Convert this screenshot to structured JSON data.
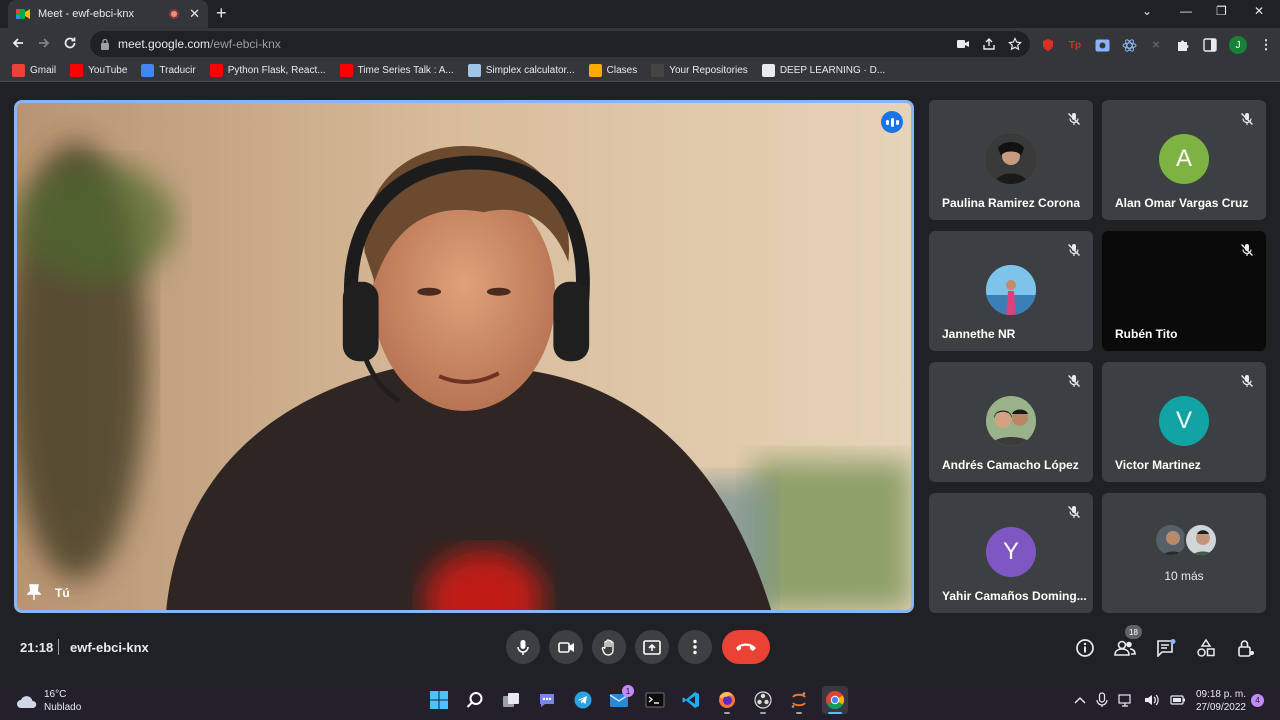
{
  "browser": {
    "tab_title": "Meet - ewf-ebci-knx",
    "url_host": "meet.google.com",
    "url_path": "/ewf-ebci-knx",
    "profile_initial": "J",
    "bookmarks": [
      {
        "label": "Gmail",
        "icon": "gmail-icon",
        "color": "#ea4335"
      },
      {
        "label": "YouTube",
        "icon": "youtube-icon",
        "color": "#ff0000"
      },
      {
        "label": "Traducir",
        "icon": "translate-icon",
        "color": "#4285f4"
      },
      {
        "label": "Python Flask, React...",
        "icon": "youtube-icon",
        "color": "#ff0000"
      },
      {
        "label": "Time Series Talk : A...",
        "icon": "youtube-icon",
        "color": "#ff0000"
      },
      {
        "label": "Simplex calculator...",
        "icon": "simplex-icon",
        "color": "#9fc5e8"
      },
      {
        "label": "Clases",
        "icon": "classroom-icon",
        "color": "#f9ab00"
      },
      {
        "label": "Your Repositories",
        "icon": "github-icon",
        "color": "#444"
      },
      {
        "label": "DEEP LEARNING · D...",
        "icon": "letter-l-icon",
        "color": "#e8eaed"
      }
    ]
  },
  "meeting": {
    "self_label": "Tú",
    "time": "21:18",
    "code": "ewf-ebci-knx",
    "participant_count": "18",
    "participants": [
      {
        "name": "Paulina Ramirez Corona",
        "initial": "",
        "avatar_color": "#111"
      },
      {
        "name": "Alan Omar Vargas Cruz",
        "initial": "A",
        "avatar_color": "#7cb342"
      },
      {
        "name": "Jannethe NR",
        "initial": "",
        "avatar_color": "#4fa3d9"
      },
      {
        "name": "Rubén Tito",
        "initial": "",
        "avatar_color": "#0a0a0a"
      },
      {
        "name": "Andrés Camacho López",
        "initial": "",
        "avatar_color": "#6b5a4a"
      },
      {
        "name": "Victor Martinez",
        "initial": "V",
        "avatar_color": "#12a4a4"
      },
      {
        "name": "Yahir Camaños Doming...",
        "initial": "Y",
        "avatar_color": "#7e57c2"
      }
    ],
    "more_label": "10 más",
    "colors": {
      "accent": "#8ab4f8",
      "end_call": "#ea4335",
      "tile": "#3c4043"
    }
  },
  "taskbar": {
    "temperature": "16°C",
    "condition": "Nublado",
    "mail_badge": "1",
    "time": "09:18 p. m.",
    "date": "27/09/2022",
    "notifications": "4"
  }
}
